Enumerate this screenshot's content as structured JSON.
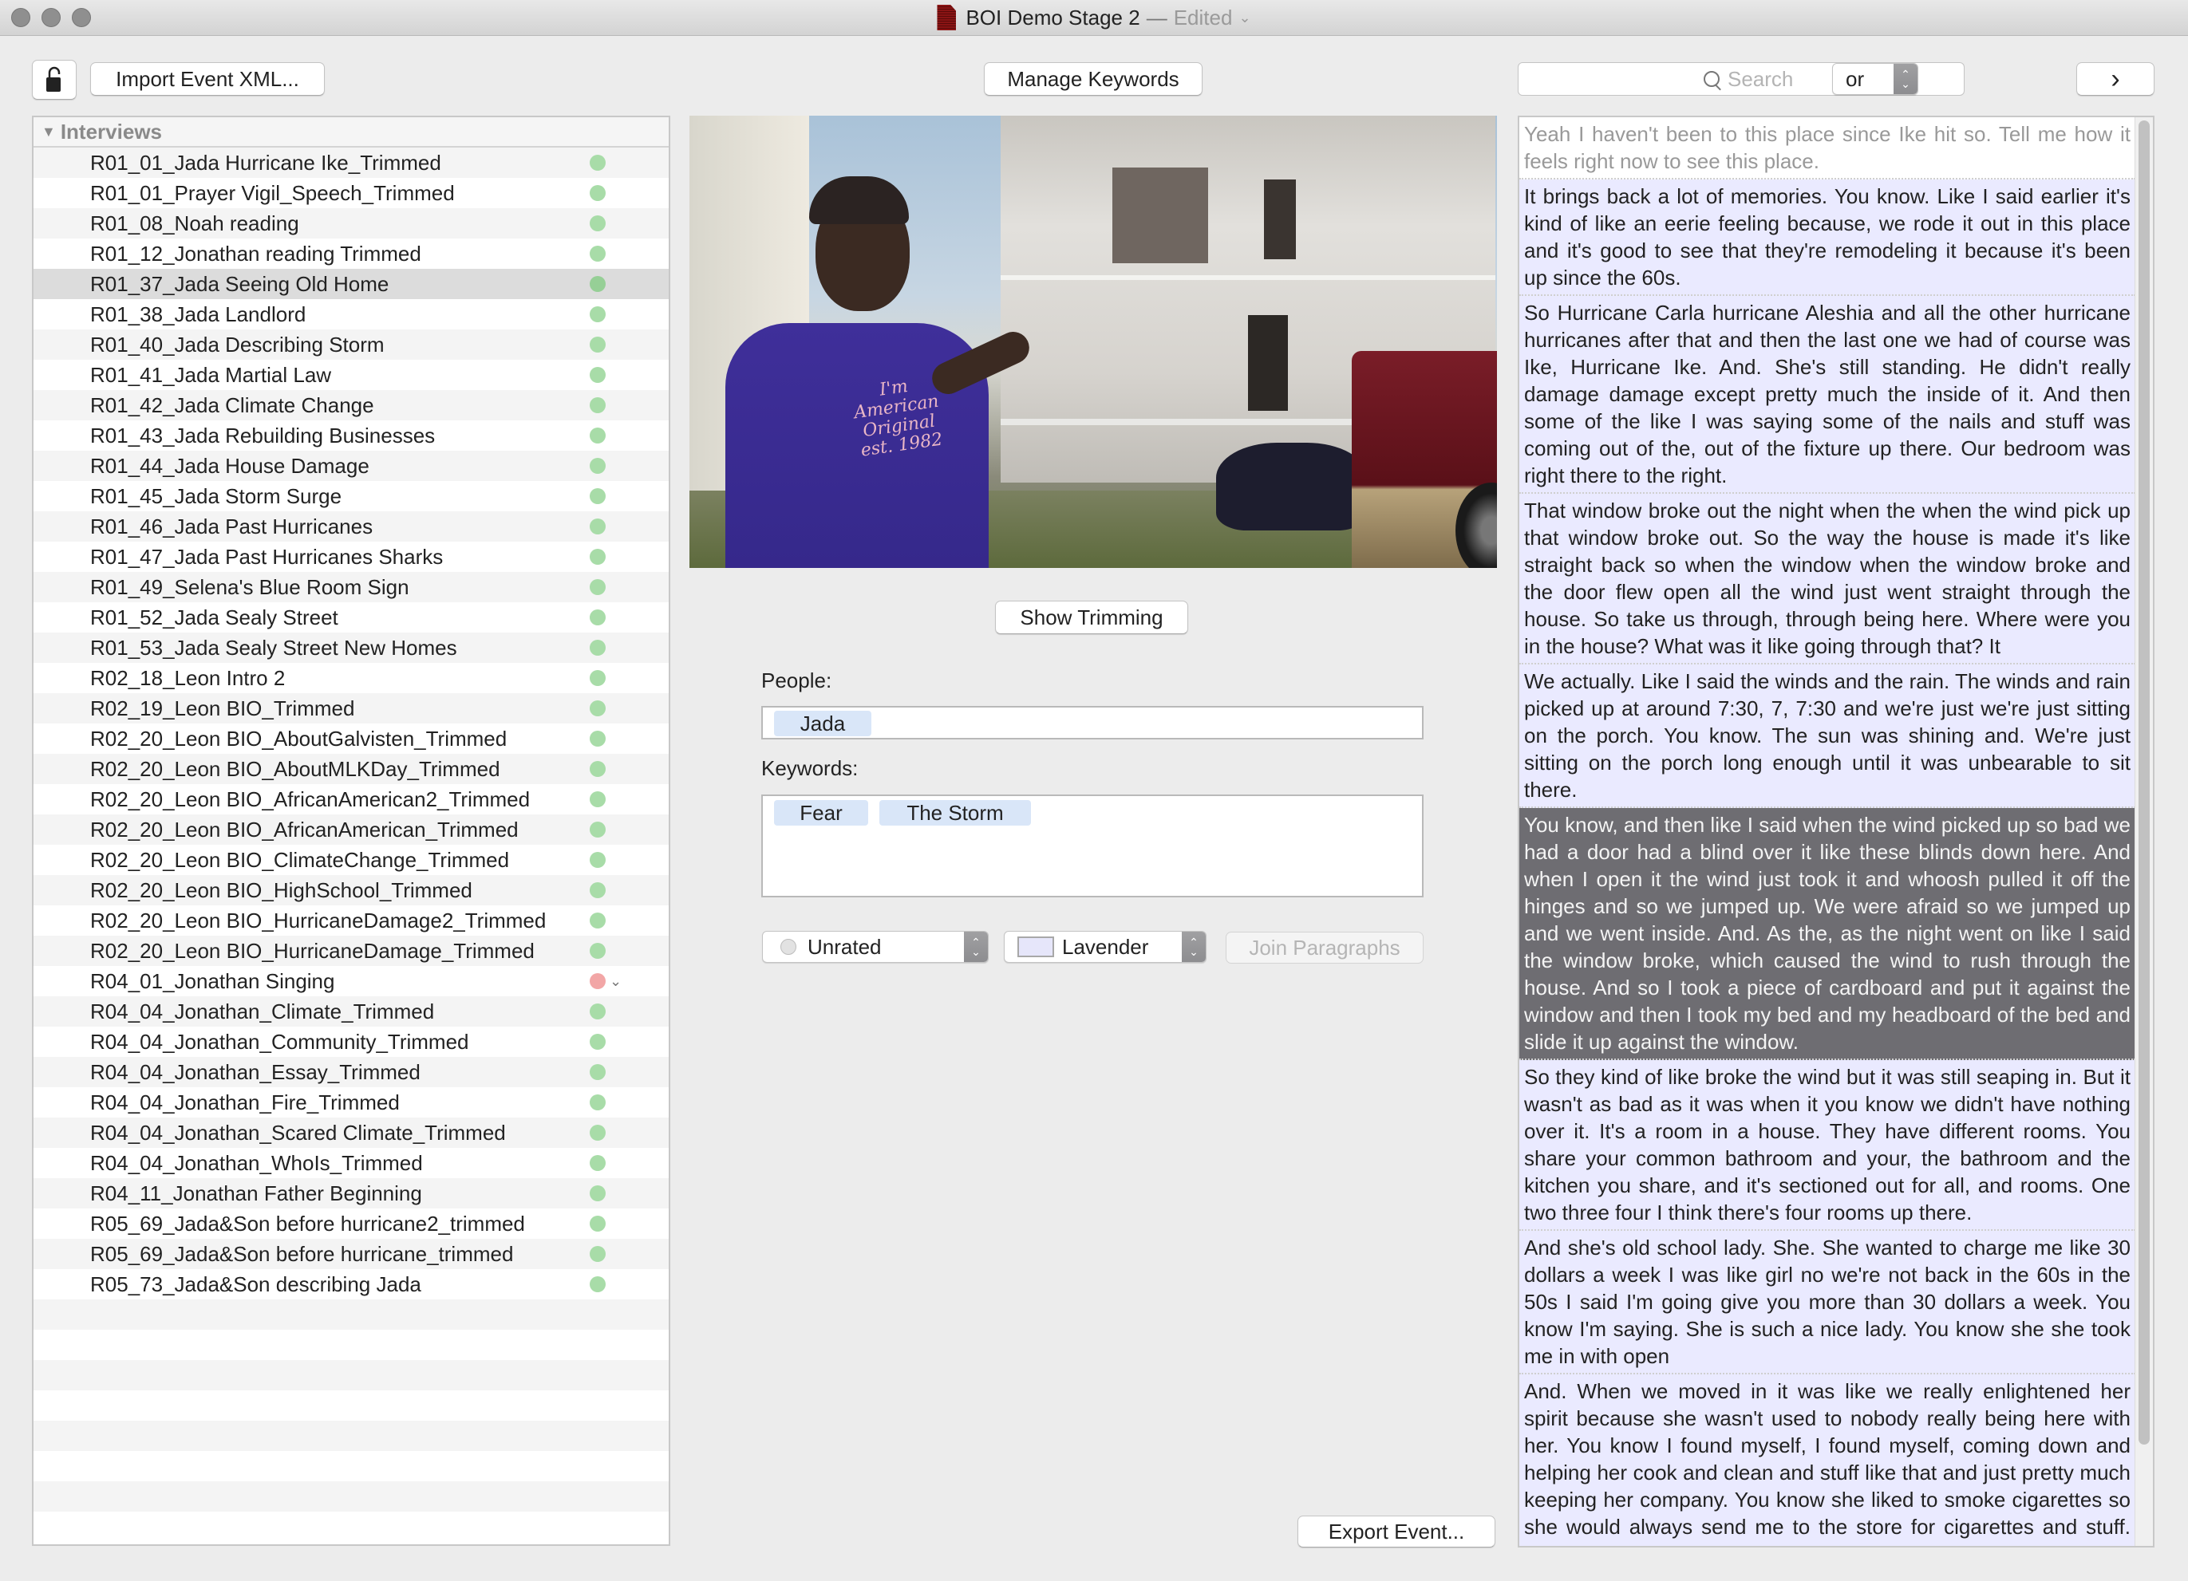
{
  "window": {
    "title": "BOI Demo Stage 2",
    "separator": "—",
    "edited_label": "Edited",
    "doc_icon": "document-icon"
  },
  "toolbar": {
    "lock_icon": "unlocked-padlock-icon",
    "import_label": "Import Event XML...",
    "manage_keywords_label": "Manage Keywords",
    "search_placeholder": "Search",
    "search_mode": "or",
    "next_label": "›"
  },
  "list": {
    "group_label": "Interviews",
    "status_colors": {
      "green": "#a8dca8",
      "red": "#f2a6a6"
    },
    "items": [
      {
        "name": "R01_01_Jada Hurricane Ike_Trimmed",
        "status": "green"
      },
      {
        "name": "R01_01_Prayer Vigil_Speech_Trimmed",
        "status": "green"
      },
      {
        "name": "R01_08_Noah reading",
        "status": "green"
      },
      {
        "name": "R01_12_Jonathan reading Trimmed",
        "status": "green"
      },
      {
        "name": "R01_37_Jada Seeing Old Home",
        "status": "green",
        "selected": true
      },
      {
        "name": "R01_38_Jada Landlord",
        "status": "green"
      },
      {
        "name": "R01_40_Jada Describing Storm",
        "status": "green"
      },
      {
        "name": "R01_41_Jada Martial Law",
        "status": "green"
      },
      {
        "name": "R01_42_Jada Climate Change",
        "status": "green"
      },
      {
        "name": "R01_43_Jada Rebuilding Businesses",
        "status": "green"
      },
      {
        "name": "R01_44_Jada House Damage",
        "status": "green"
      },
      {
        "name": "R01_45_Jada Storm Surge",
        "status": "green"
      },
      {
        "name": "R01_46_Jada Past Hurricanes",
        "status": "green"
      },
      {
        "name": "R01_47_Jada Past Hurricanes Sharks",
        "status": "green"
      },
      {
        "name": "R01_49_Selena's Blue Room Sign",
        "status": "green"
      },
      {
        "name": "R01_52_Jada Sealy Street",
        "status": "green"
      },
      {
        "name": "R01_53_Jada Sealy Street New Homes",
        "status": "green"
      },
      {
        "name": "R02_18_Leon Intro 2",
        "status": "green"
      },
      {
        "name": "R02_19_Leon BIO_Trimmed",
        "status": "green"
      },
      {
        "name": "R02_20_Leon BIO_AboutGalvisten_Trimmed",
        "status": "green"
      },
      {
        "name": "R02_20_Leon BIO_AboutMLKDay_Trimmed",
        "status": "green"
      },
      {
        "name": "R02_20_Leon BIO_AfricanAmerican2_Trimmed",
        "status": "green"
      },
      {
        "name": "R02_20_Leon BIO_AfricanAmerican_Trimmed",
        "status": "green"
      },
      {
        "name": "R02_20_Leon BIO_ClimateChange_Trimmed",
        "status": "green"
      },
      {
        "name": "R02_20_Leon BIO_HighSchool_Trimmed",
        "status": "green"
      },
      {
        "name": "R02_20_Leon BIO_HurricaneDamage2_Trimmed",
        "status": "green"
      },
      {
        "name": "R02_20_Leon BIO_HurricaneDamage_Trimmed",
        "status": "green"
      },
      {
        "name": "R04_01_Jonathan Singing",
        "status": "red",
        "menu": true
      },
      {
        "name": "R04_04_Jonathan_Climate_Trimmed",
        "status": "green"
      },
      {
        "name": "R04_04_Jonathan_Community_Trimmed",
        "status": "green"
      },
      {
        "name": "R04_04_Jonathan_Essay_Trimmed",
        "status": "green"
      },
      {
        "name": "R04_04_Jonathan_Fire_Trimmed",
        "status": "green"
      },
      {
        "name": "R04_04_Jonathan_Scared Climate_Trimmed",
        "status": "green"
      },
      {
        "name": "R04_04_Jonathan_WhoIs_Trimmed",
        "status": "green"
      },
      {
        "name": "R04_11_Jonathan Father Beginning",
        "status": "green"
      },
      {
        "name": "R05_69_Jada&Son before hurricane2_trimmed",
        "status": "green"
      },
      {
        "name": "R05_69_Jada&Son before hurricane_trimmed",
        "status": "green"
      },
      {
        "name": "R05_73_Jada&Son describing Jada",
        "status": "green"
      }
    ]
  },
  "video": {
    "shirt_text": "I'm American Original est. 1982"
  },
  "details": {
    "show_trimming_label": "Show Trimming",
    "people_label": "People:",
    "people": [
      "Jada"
    ],
    "keywords_label": "Keywords:",
    "keywords": [
      "Fear",
      "The Storm"
    ],
    "rating": "Unrated",
    "color_label": "Lavender",
    "color_value": "#e6e6fa",
    "join_label": "Join Paragraphs",
    "export_label": "Export Event..."
  },
  "transcript": {
    "paragraphs": [
      {
        "text": "Yeah I haven't been to this place since Ike hit so. Tell me how it feels right now to see this place.",
        "style": "first"
      },
      {
        "text": "It brings back a lot of memories. You know. Like I said earlier it's kind of like an eerie feeling because, we rode it out in this place and it's good to see that they're remodeling it because it's been up since the 60s.",
        "style": "normal"
      },
      {
        "text": "So Hurricane Carla hurricane Aleshia and all the other hurricane hurricanes after that and then the last one we had of course was Ike, Hurricane Ike. And. She's still standing. He didn't really damage damage except pretty much the inside of it. And then some of the like I was saying some of the nails and stuff was coming out of the, out of the fixture up there. Our bedroom was right there to the right.",
        "style": "normal"
      },
      {
        "text": "That window broke out the night when the when the wind pick up that window broke out. So the way the house is made it's like straight back so when the window when the window broke and the door flew open all the wind just went straight through the house. So take us through, through being here. Where were you in the house? What was it like going through that? It",
        "style": "normal"
      },
      {
        "text": "We actually. Like I said the winds and the rain. The winds and rain picked up at around 7:30, 7, 7:30 and we're just we're just sitting on the porch. You know. The sun was shining and. We're just sitting on the porch long enough until it was unbearable to sit there.",
        "style": "normal"
      },
      {
        "text": "You know, and then like I said when the wind picked up so bad we had a door had a blind over it like these blinds down here. And when I open it the wind just took it and whoosh pulled it off the hinges and so we jumped up. We were afraid so we jumped up and we went inside. And. As the, as the night went on like I said the window broke, which caused the wind to rush through the house. And so I took a piece of cardboard and put it against the window and then I took my bed and my headboard of the bed and slide it up against the window.",
        "style": "selected"
      },
      {
        "text": "So they kind of like broke the wind but it was still seaping in. But it wasn't as bad as it was when it you know we didn't have nothing over it. It's a room in a house. They have different rooms. You share your common bathroom and your, the bathroom and the kitchen you share, and it's sectioned out for all, and rooms. One two three four I think there's four rooms up there.",
        "style": "normal"
      },
      {
        "text": "And she's old school lady. She. She wanted to charge me like 30 dollars a week I was like girl no we're not back in the 60s in the 50s I said I'm going give you more than 30 dollars a week. You know I'm saying. She is such a nice lady. You know she she took me in with open",
        "style": "normal"
      },
      {
        "text": "And. When we moved in it was like we really enlightened her spirit because she wasn't used to nobody really being here with her. You know I found myself, I found myself, coming down and helping her cook and clean and stuff like that and just pretty much keeping her company. You know she liked to smoke cigarettes so she would always send me to the store for cigarettes and stuff. And that was her place. Oh my God it",
        "style": "normal"
      }
    ]
  }
}
